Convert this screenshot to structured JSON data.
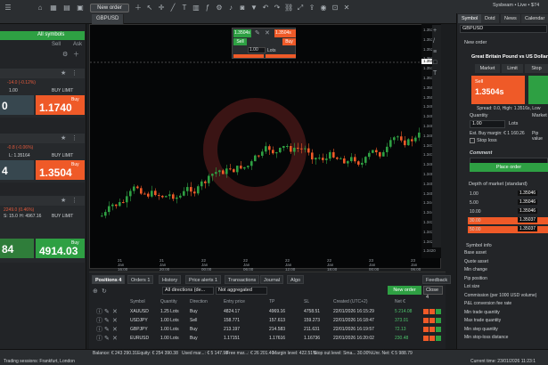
{
  "topbar": {
    "new_order": "New order",
    "user_status": "Sysbeam • Live • $74",
    "chart_tab": "GBPUSD"
  },
  "left": {
    "header": "All symbols",
    "col_sell": "Sell",
    "col_ask": "Ask",
    "cards": [
      {
        "change": "-14.0 (-0.12%)",
        "lots": "1.00",
        "mode": "BUY LIMIT",
        "sell_price": "0",
        "buy_label": "Buy",
        "buy_price": "1.1740",
        "bid_suffix": "8"
      },
      {
        "change": "-0.8 (-0.06%)",
        "lots": "L: 1.35164",
        "mode": "BUY LIMIT",
        "sell_price": "4",
        "buy_label": "Buy",
        "buy_price": "1.3504",
        "bid_suffix": "4"
      },
      {
        "change": "2249.0 (0.46%)",
        "lots": "H: 4967.16",
        "mode": "BUY LIMIT",
        "sell_price": "4",
        "buy_label": "Buy",
        "buy_price": "4914.03",
        "bid_suffix": "84",
        "extra": "S: 15.0"
      }
    ]
  },
  "chart": {
    "symbol": "GBPUSD",
    "mini_sell": "1.3504s",
    "mini_buy": "1.3504s",
    "mini_sell_label": "Sell",
    "mini_buy_label": "Buy",
    "mini_qty": "1.00",
    "mini_lots": "Lots",
    "price_labels": [
      "1.3535",
      "1.3530",
      "1.3525",
      "1.3520",
      "1.3515",
      "1.3510",
      "1.3505",
      "1.3500",
      "1.3495",
      "1.3490",
      "1.3485",
      "1.3480",
      "1.3475",
      "1.3470",
      "1.3465",
      "1.3460",
      "1.3455",
      "1.3450",
      "1.3445",
      "1.3440",
      "1.3435",
      "1.3430",
      "1.3425",
      "1.3420"
    ],
    "current_price": "1.35046",
    "time_labels": [
      "21 Jan 16:00",
      "21 Jan 20:00",
      "22 Jan 00:00",
      "22 Jan 06:00",
      "22 Jan 12:00",
      "22 Jan 18:00",
      "23 Jan 00:00",
      "23 Jan 06:00"
    ]
  },
  "positions": {
    "tabs": [
      "Positions 4",
      "Orders 1",
      "History",
      "Price alerts 1",
      "Transactions",
      "Journal",
      "Algo"
    ],
    "feedback": "Feedback",
    "filter_dir": "All directions (de...",
    "filter_agg": "Not aggregated",
    "new_order": "New order",
    "close": "Close",
    "close_count": "4",
    "columns": [
      "Symbol",
      "Quantity",
      "Direction",
      "Entry price",
      "TP",
      "SL",
      "Created (UTC+2)",
      "Net €"
    ],
    "rows": [
      {
        "symbol": "XAUUSD",
        "qty": "1.25 Lots",
        "dir": "Buy",
        "entry": "4824.17",
        "tp": "4969.16",
        "sl": "4758.51",
        "created": "22/01/2026 16:15:29",
        "net": "5 214.08"
      },
      {
        "symbol": "USDJPY",
        "qty": "1.00 Lots",
        "dir": "Sell",
        "entry": "158.771",
        "tp": "157.613",
        "sl": "159.273",
        "created": "22/01/2026 16:18:47",
        "net": "373.01"
      },
      {
        "symbol": "GBPJPY",
        "qty": "1.00 Lots",
        "dir": "Buy",
        "entry": "213.197",
        "tp": "214.583",
        "sl": "211.631",
        "created": "22/01/2026 16:19:57",
        "net": "72.13"
      },
      {
        "symbol": "EURUSD",
        "qty": "1.00 Lots",
        "dir": "Buy",
        "entry": "1.17151",
        "tp": "1.17616",
        "sl": "1.16736",
        "created": "22/01/2026 16:20:02",
        "net": "230.48"
      }
    ]
  },
  "right": {
    "tabs": [
      "Symbol",
      "Dotd",
      "News",
      "Calendar"
    ],
    "symbol": "GBPUSD",
    "new_order": "New order",
    "instrument": "Great Britain Pound vs US Dollar",
    "order_types": [
      "Market",
      "Limit",
      "Stop"
    ],
    "sell_label": "Sell",
    "sell_price": "1.3504s",
    "spread": "Spread: 0.0, High: 1.3516s, Low",
    "quantity_label": "Quantity",
    "quantity": "1.00",
    "market_label": "Market",
    "lots_label": "Lots",
    "est_buy": "Est. Buy margin: € 1 160.26",
    "pip_value": "Pip value",
    "stop_loss": "Stop loss",
    "comment": "Comment",
    "place_order": "Place order",
    "depth_title": "Depth of market (standard)",
    "depth": [
      {
        "qty": "1.00",
        "price": "1.35046"
      },
      {
        "qty": "5.00",
        "price": "1.35046"
      },
      {
        "qty": "10.00",
        "price": "1.35046"
      },
      {
        "qty": "30.00",
        "price": "1.35037"
      },
      {
        "qty": "50.00",
        "price": "1.35037"
      }
    ],
    "info_title": "Symbol info",
    "info_rows": [
      "Base asset",
      "Quote asset",
      "Min change",
      "Pip position",
      "Lot size",
      "Commission (per 1000 USD volume)",
      "P&L conversion fee rate",
      "Min trade quantity",
      "Max trade quantity",
      "Min step quantity",
      "Min stop-loss distance"
    ]
  },
  "status": {
    "balance": "Balance: € 243 290.31",
    "equity": "Equity: € 254 390.38",
    "used_margin": "Used mar...: € 5 147.98",
    "free_margin": "Free mar...: € 26 201.40",
    "margin_level": "Margin level: 422.51%",
    "stop_out": "Stop out level: Sma... 30.00%",
    "unr_net": "Unr. Net: € 5 988.79",
    "trading": "Trading sessions: Frankfurt, London",
    "time": "Current time: 23/01/2026 11:23:1"
  }
}
